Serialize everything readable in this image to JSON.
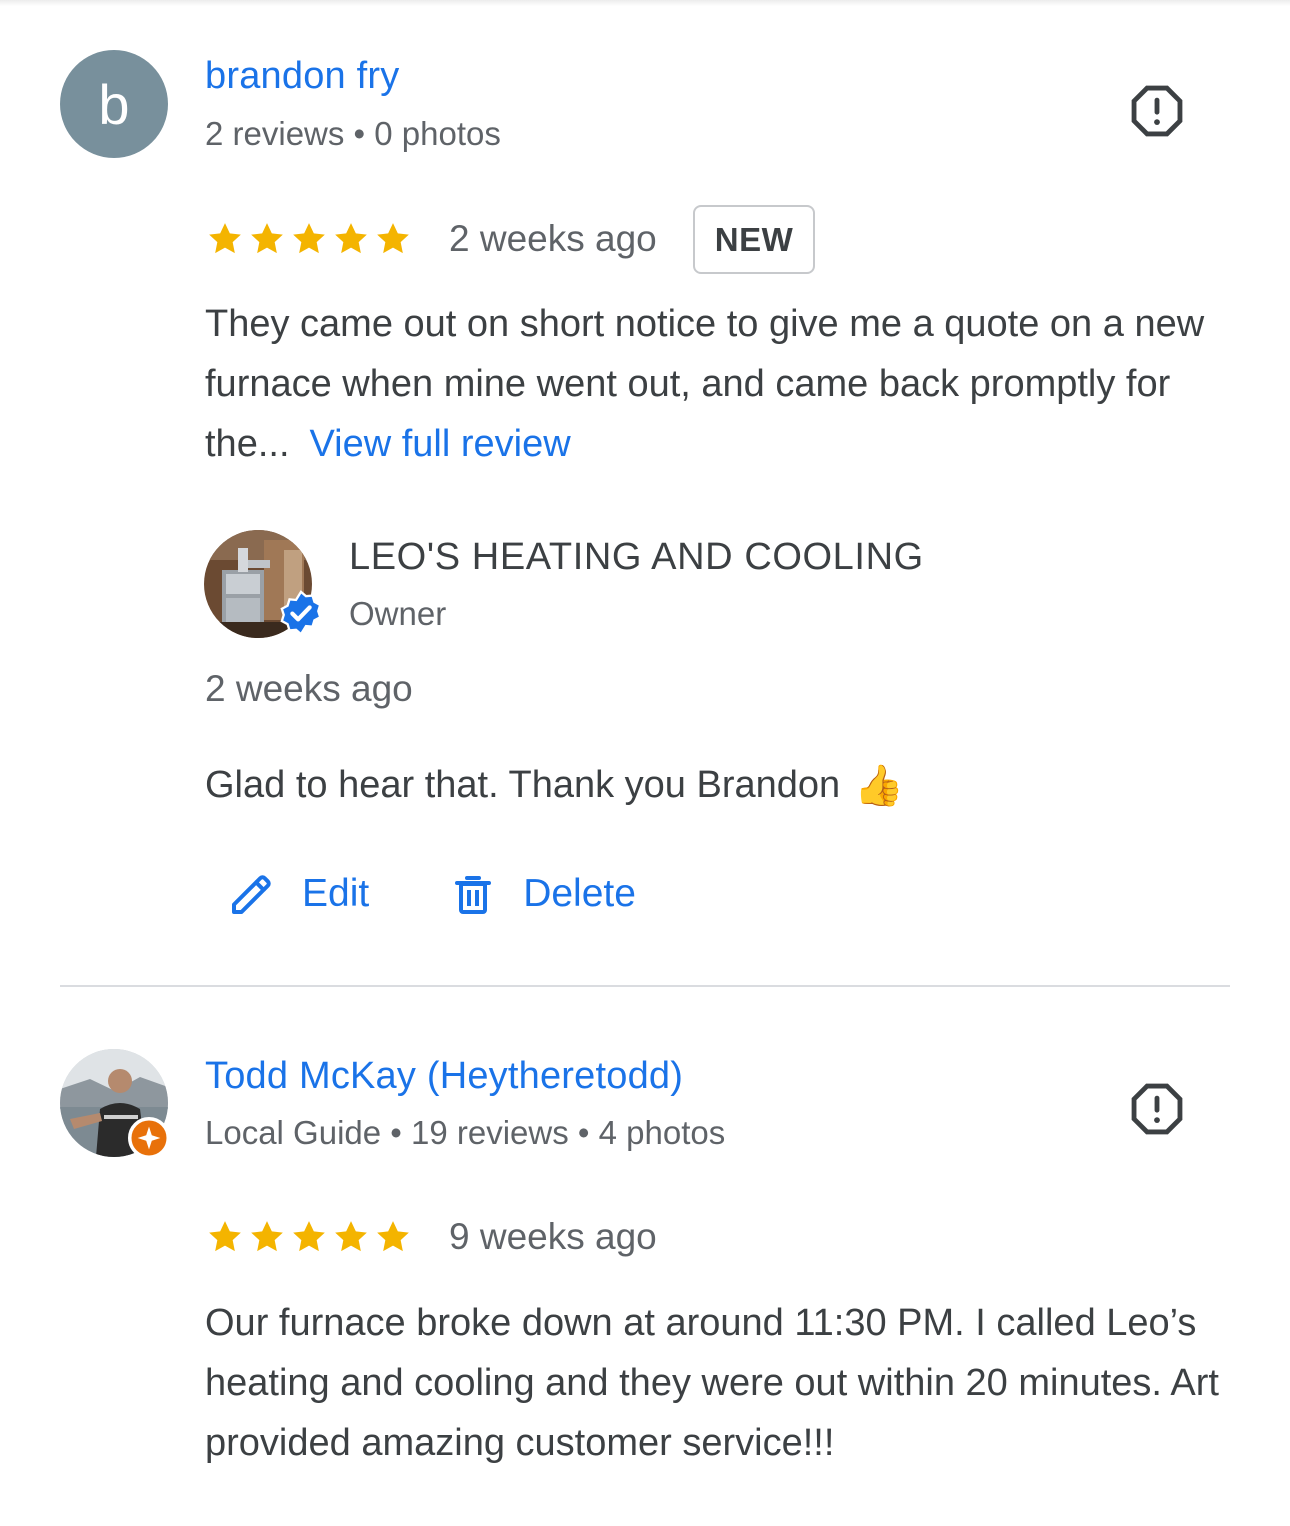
{
  "reviews": [
    {
      "avatar_letter": "b",
      "name": "brandon fry",
      "meta": "2 reviews • 0 photos",
      "rating": 5,
      "time": "2 weeks ago",
      "badge": "NEW",
      "text": "They came out on short notice to give me a quote on a new furnace when mine went out, and came back promptly for the...",
      "link": "View full review",
      "owner_reply": {
        "name": "LEO'S HEATING AND COOLING",
        "role": "Owner",
        "time": "2 weeks ago",
        "text": "Glad to hear that. Thank you Brandon",
        "emoji": "👍"
      },
      "actions": {
        "edit": "Edit",
        "delete": "Delete"
      }
    },
    {
      "name": "Todd McKay (Heytheretodd)",
      "meta": "Local Guide • 19 reviews • 4 photos",
      "rating": 5,
      "time": "9 weeks ago",
      "text": "Our furnace broke down at around 11:30 PM. I called Leo’s heating and cooling and they were out within 20 minutes. Art provided amazing customer service!!!"
    }
  ],
  "colors": {
    "link": "#1a73e8",
    "star": "#f4b400",
    "avatar_letter_bg": "#78909c",
    "local_guide": "#e8710a"
  },
  "icons": {
    "flag": "report-icon",
    "edit": "pencil-icon",
    "delete": "trash-icon",
    "verified": "verified-badge-icon"
  }
}
